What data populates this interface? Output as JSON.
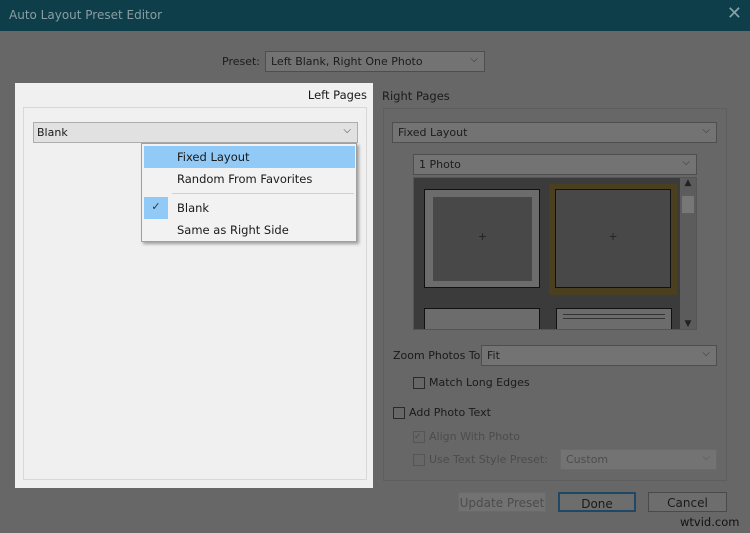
{
  "window": {
    "title": "Auto Layout Preset Editor",
    "close": "✕"
  },
  "preset": {
    "label": "Preset:",
    "value": "Left Blank, Right One Photo"
  },
  "left": {
    "title": "Left Pages",
    "select": "Blank",
    "menu": [
      {
        "label": "Fixed Layout",
        "highlighted": true
      },
      {
        "label": "Random From Favorites"
      },
      {
        "label": "Blank",
        "checked": true
      },
      {
        "label": "Same as Right Side"
      }
    ]
  },
  "right": {
    "title": "Right Pages",
    "mode": "Fixed Layout",
    "layout": "1 Photo",
    "zoom_label": "Zoom Photos To:",
    "zoom_value": "Fit",
    "match_long_edges": "Match Long Edges",
    "add_photo_text": "Add Photo Text",
    "align_with_photo": "Align With Photo",
    "use_text_style": "Use Text Style Preset:",
    "text_style_value": "Custom"
  },
  "buttons": {
    "update": "Update Preset",
    "done": "Done",
    "cancel": "Cancel"
  },
  "watermark": "wtvid.com",
  "colors": {
    "titlebar": "#0d3e4a",
    "highlight": "#91c9f7",
    "selected_frame": "#6b5a22"
  }
}
